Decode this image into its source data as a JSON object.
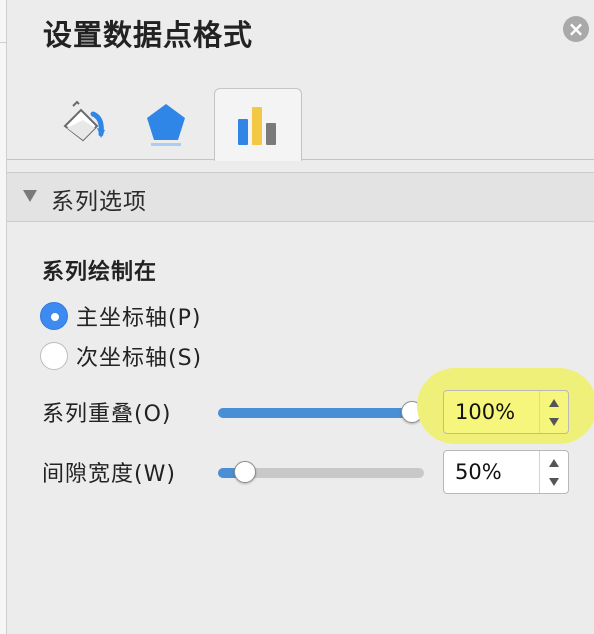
{
  "pane": {
    "title": "设置数据点格式"
  },
  "tabs": [
    {
      "icon": "fill-bucket-icon",
      "selected": false
    },
    {
      "icon": "pentagon-shape-icon",
      "selected": false
    },
    {
      "icon": "bar-chart-icon",
      "selected": true
    }
  ],
  "section": {
    "title": "系列选项",
    "plot_on": {
      "label": "系列绘制在",
      "options": [
        {
          "label": "主坐标轴(P)",
          "checked": true
        },
        {
          "label": "次坐标轴(S)",
          "checked": false
        }
      ]
    },
    "overlap": {
      "label": "系列重叠(O)",
      "value_text": "100%",
      "slider_fraction": 0.94
    },
    "gap_width": {
      "label": "间隙宽度(W)",
      "value_text": "50%",
      "slider_fraction": 0.13
    }
  },
  "colors": {
    "accent": "#3d8bf0",
    "highlight": "#eff07a",
    "slider_fill": "#4a8fd6"
  }
}
